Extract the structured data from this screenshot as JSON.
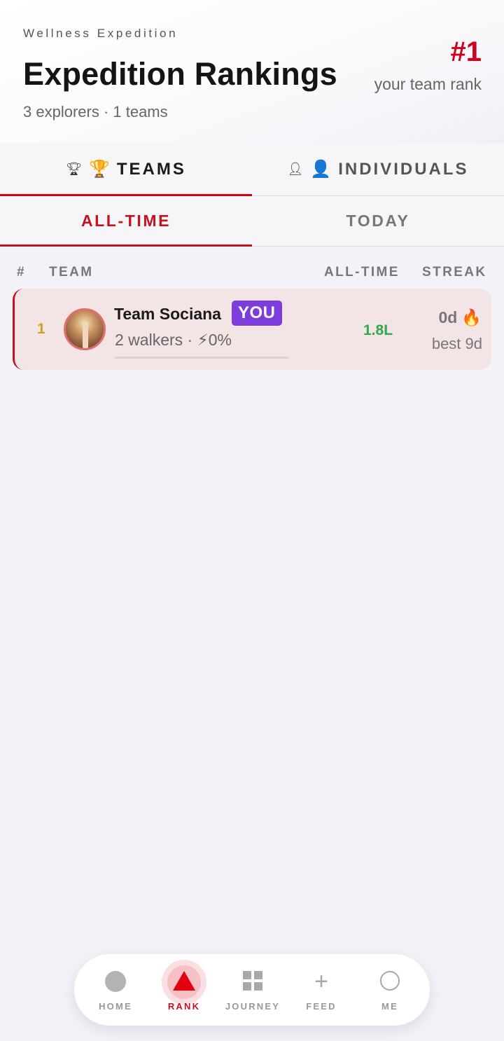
{
  "header": {
    "eyebrow": "Wellness Expedition",
    "title": "Expedition Rankings",
    "subtitle": "3 explorers · 1 teams",
    "rank_value": "#1",
    "rank_label": "your team rank"
  },
  "main_tabs": [
    {
      "icon_small": "🏆︎",
      "icon_emoji": "🏆",
      "label": "TEAMS",
      "active": true
    },
    {
      "icon_small": "👤︎",
      "icon_emoji": "👤",
      "label": "INDIVIDUALS",
      "active": false
    }
  ],
  "sub_tabs": [
    {
      "label": "ALL-TIME",
      "active": true
    },
    {
      "label": "TODAY",
      "active": false
    }
  ],
  "columns": {
    "rank": "#",
    "team": "TEAM",
    "alltime": "ALL-TIME",
    "streak": "STREAK"
  },
  "rows": [
    {
      "rank": "1",
      "name": "Team Sociana",
      "badge": "YOU",
      "meta": "2 walkers · ⚡0%",
      "progress": 0,
      "alltime": "1.8L",
      "streak": "0d",
      "streak_icon": "🔥",
      "best": "best 9d"
    }
  ],
  "nav": [
    {
      "label": "HOME",
      "icon": "home-circle-icon",
      "active": false
    },
    {
      "label": "RANK",
      "icon": "triangle-icon",
      "active": true
    },
    {
      "label": "JOURNEY",
      "icon": "grid-icon",
      "active": false
    },
    {
      "label": "FEED",
      "icon": "plus-icon",
      "active": false
    },
    {
      "label": "ME",
      "icon": "ring-icon",
      "active": false
    }
  ],
  "colors": {
    "accent": "#d0021b",
    "badge": "#7d3cdc",
    "positive": "#2ea84b",
    "rank_gold": "#d4a017"
  }
}
